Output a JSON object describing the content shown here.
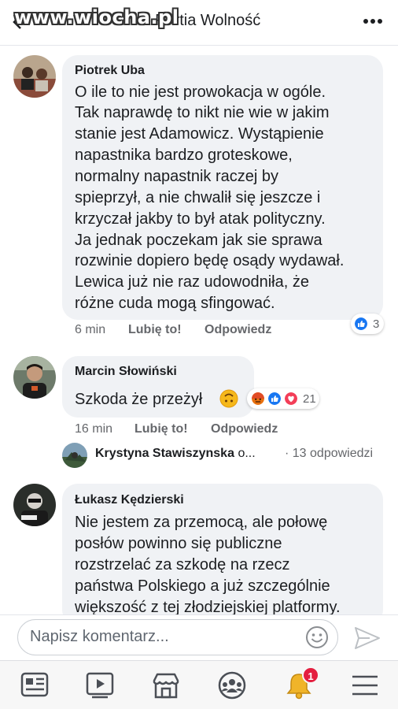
{
  "header": {
    "title": "st Partia Wolność",
    "watermark": "www.wiocha.pl"
  },
  "comments": [
    {
      "author": "Piotrek Uba",
      "text": "O ile to nie jest prowokacja w ogóle. Tak naprawdę to nikt nie wie w jakim stanie jest Adamowicz. Wystąpienie napastnika bardzo groteskowe, normalny napastnik raczej by spieprzył, a nie chwalił się jeszcze i krzyczał jakby to był atak polityczny. Ja jednak poczekam jak sie sprawa rozwinie dopiero będę osądy wydawał. Lewica już nie raz udowodniła, że różne cuda mogą sfingować.",
      "lines": [
        "O ile to nie jest prowokacja w ogóle.",
        "Tak naprawdę to nikt nie wie w jakim",
        "stanie jest Adamowicz. Wystąpienie",
        "napastnika bardzo groteskowe,",
        "normalny napastnik raczej by",
        "spieprzył, a nie chwalił się jeszcze i",
        "krzyczał jakby to był atak polityczny.",
        "Ja jednak poczekam jak sie sprawa",
        "rozwinie dopiero będę osądy wydawał.",
        "Lewica już nie raz udowodniła, że",
        "różne cuda mogą sfingować."
      ],
      "time": "6 min",
      "like": "Lubię to!",
      "reply": "Odpowiedz",
      "reactions": "3"
    },
    {
      "author": "Marcin Słowiński",
      "text": "Szkoda że przeżył",
      "time": "16 min",
      "like": "Lubię to!",
      "reply": "Odpowiedz",
      "reactions": "21",
      "reply_preview": {
        "author": "Krystyna Stawiszynska",
        "ellipsis": "o...",
        "count": "· 13 odpowiedzi"
      }
    },
    {
      "author": "Łukasz Kędzierski",
      "lines": [
        "Nie jestem za przemocą, ale połowę",
        "posłów powinno się publiczne",
        "rozstrzelać za szkodę na rzecz",
        "państwa Polskiego a już szczególnie",
        "większość z tej złodziejskiej platformy."
      ]
    }
  ],
  "composer": {
    "placeholder": "Napisz komentarz..."
  },
  "tabs": [
    "news-feed",
    "watch",
    "marketplace",
    "groups",
    "notifications",
    "menu"
  ],
  "notifications_badge": "1",
  "colors": {
    "bubble": "#f0f2f5",
    "like_blue": "#1877f2",
    "love_red": "#f33e58",
    "angry_orange": "#e9710f",
    "badge_red": "#e41e3f"
  }
}
